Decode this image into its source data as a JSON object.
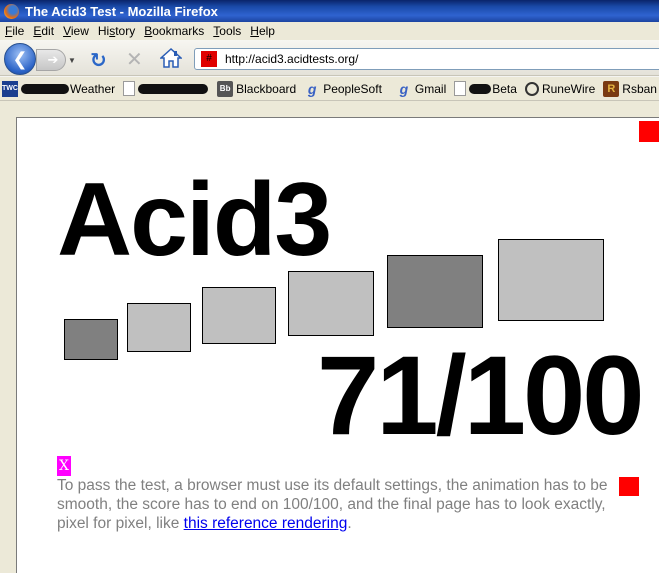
{
  "window": {
    "title": "The Acid3 Test - Mozilla Firefox"
  },
  "menu": [
    "File",
    "Edit",
    "View",
    "History",
    "Bookmarks",
    "Tools",
    "Help"
  ],
  "menu_access": [
    "F",
    "E",
    "V",
    "H",
    "B",
    "T",
    "H"
  ],
  "nav": {
    "url": "http://acid3.acidtests.org/"
  },
  "bookmarks": {
    "twc_icon_text": "TWC",
    "weather": "Weather",
    "blackboard_icon_text": "Bb",
    "blackboard": "Blackboard",
    "google_icon_text": "g",
    "peoplesoft": "PeopleSoft",
    "gmail": "Gmail",
    "beta": "Beta",
    "runewire": "RuneWire",
    "rsbandb_icon_text": "R",
    "rsbandb": "Rsban"
  },
  "page": {
    "title": "Acid3",
    "score": "71/100",
    "x_glyph": "X",
    "instructions": "To pass the test, a browser must use its default settings, the animation has to be smooth, the score has to end on 100/100, and the final page has to look exactly, pixel for pixel, like ",
    "link_text": "this reference rendering",
    "trailing": "."
  },
  "colors": {
    "dark_bucket": "#808080",
    "light_bucket": "#c0c0c0",
    "red": "#ff0000",
    "magenta": "#ff00ff",
    "link": "#0000ee"
  }
}
